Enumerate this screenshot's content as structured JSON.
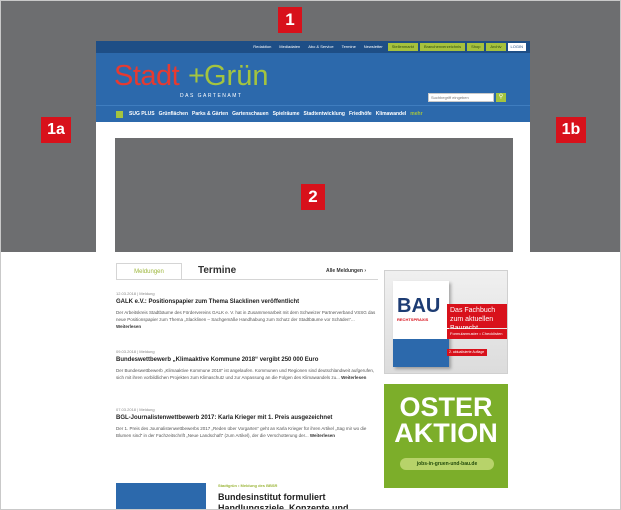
{
  "markers": {
    "m1": "1",
    "m1a": "1a",
    "m1b": "1b",
    "m2": "2"
  },
  "utility_nav": {
    "links": [
      "Redaktion",
      "Mediadaten",
      "Abo & Service",
      "Termine",
      "Newsletter"
    ],
    "green_links": [
      "Stellenmarkt",
      "Branchenverzeichnis",
      "Shop",
      "Archiv"
    ],
    "login": "LOGIN"
  },
  "logo": {
    "part1": "Stadt",
    "plus": "+",
    "part2": "Grün",
    "subtitle": "DAS GARTENAMT"
  },
  "search": {
    "placeholder": "Suchbegriff eingeben"
  },
  "main_nav": {
    "items": [
      "SUG PLUS",
      "Grünflächen",
      "Parks & Gärten",
      "Gartenschauen",
      "Spielräume",
      "Stadtentwicklung",
      "Friedhöfe",
      "Klimawandel"
    ],
    "more": "mehr"
  },
  "tabs": {
    "active": "Meldungen",
    "inactive": "Termine",
    "all": "Alle Meldungen"
  },
  "news": [
    {
      "date": "12.03.2018 | Meldung",
      "title": "GALK e.V.: Positionspapier zum Thema Slacklinen veröffentlicht",
      "body": "Der Arbeitskreis Stadtbäume des Fördervereins GALK e. V. hat in Zusammenarbeit mit dem Schweizer Partnerverband VSSG das neue Positionspapier zum Thema „Slacklinen – Sachgemäße Handhabung zum Schutz der Stadtbäume vor Schäden“...",
      "more": "Weiterlesen"
    },
    {
      "date": "09.03.2018 | Meldung",
      "title": "Bundeswettbewerb „Klimaaktive Kommune 2018“ vergibt 250 000 Euro",
      "body": "Der Bundeswettbewerb „Klimaaktive Kommune 2018“ ist angelaufen. Kommunen und Regionen sind deutschlandweit aufgerufen, sich mit ihren vorbildlichen Projekten zum Klimaschutz und zur Anpassung an die Folgen des Klimawandels zu...",
      "more": "Weiterlesen"
    },
    {
      "date": "07.03.2018 | Meldung",
      "title": "BGL-Journalistenwettbewerb 2017: Karla Krieger mit 1. Preis ausgezeichnet",
      "body": "Der 1. Preis des Journalistenwettbewerbs 2017 „Reden über Vorgarten“ geht an Karla Krieger für ihren Artikel „Sag mir wo die Blumen sind“ in der Fachzeitschrift „Neue Landschaft“ (zum Artikel), der die Verschotterung der...",
      "more": "Weiterlesen"
    }
  ],
  "ad_bau": {
    "book_title": "BAU",
    "book_sub": "RECHTSPRAXIS",
    "headline": "Das Fachbuch zum aktuellen Baurecht",
    "bullets": "Formularmuster • Checklisten",
    "tag": "2. aktualisierte Auflage"
  },
  "ad_oster": {
    "line1": "OSTER",
    "line2": "AKTION",
    "url": "jobs-in-gruen-und-bau.de"
  },
  "promo": {
    "kicker": "Stadtgrün • Meldung des BBSR",
    "title": "Bundesinstitut formuliert Handlungsziele, Konzepte und"
  }
}
